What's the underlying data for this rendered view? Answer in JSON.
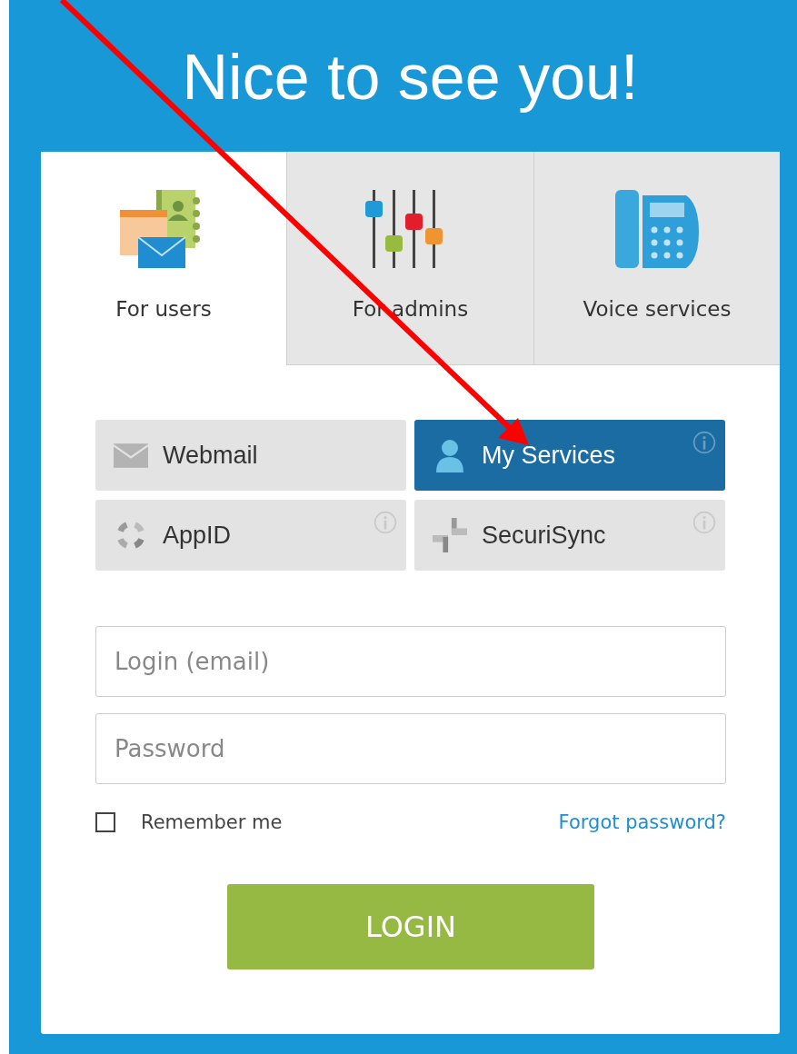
{
  "title": "Nice to see you!",
  "tabs": [
    {
      "label": "For users",
      "kind": "calendar",
      "selected": true
    },
    {
      "label": "For admins",
      "kind": "sliders",
      "selected": false
    },
    {
      "label": "Voice services",
      "kind": "phone",
      "selected": false
    }
  ],
  "services": [
    {
      "label": "Webmail",
      "kind": "mail",
      "info": false,
      "selected": false
    },
    {
      "label": "My Services",
      "kind": "person",
      "info": true,
      "selected": true
    },
    {
      "label": "AppID",
      "kind": "ring",
      "info": true,
      "selected": false
    },
    {
      "label": "SecuriSync",
      "kind": "cross",
      "info": true,
      "selected": false
    }
  ],
  "fields": [
    {
      "placeholder": "Login (email)"
    },
    {
      "placeholder": "Password"
    }
  ],
  "remember": {
    "label": "Remember me",
    "checked": false
  },
  "forgot_link": "Forgot password?",
  "login_button": "LOGIN"
}
